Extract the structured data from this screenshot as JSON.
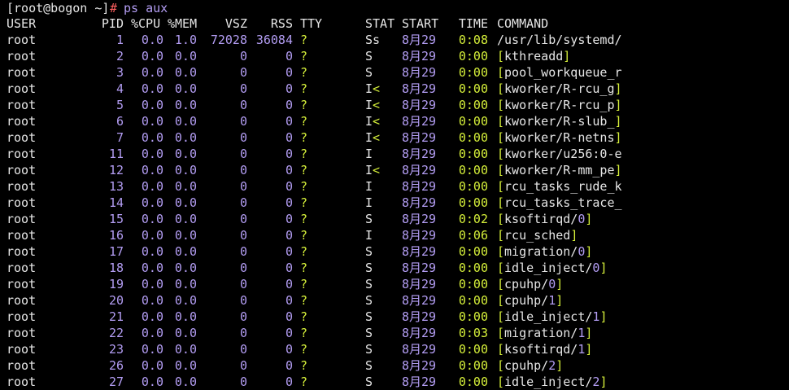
{
  "prompt": {
    "user_host": "[root@bogon ~]",
    "symbol": "#",
    "command": "ps aux"
  },
  "header": {
    "user": "USER",
    "pid": "PID",
    "cpu": "%CPU",
    "mem": "%MEM",
    "vsz": "VSZ",
    "rss": "RSS",
    "tty": "TTY",
    "stat": "STAT",
    "start": "START",
    "time": "TIME",
    "command": "COMMAND"
  },
  "colors": {
    "background": "#000000",
    "text": "#e6e6e6",
    "number": "#b39df3",
    "accent": "#d6f03a",
    "prompt_hash": "#ff5f5f"
  },
  "rows": [
    {
      "user": "root",
      "pid": "1",
      "cpu": "0.0",
      "mem": "1.0",
      "vsz": "72028",
      "rss": "36084",
      "tty": "?",
      "stat": "Ss",
      "start": "8月29",
      "time": "0:08",
      "command": "/usr/lib/systemd/",
      "bracket": false
    },
    {
      "user": "root",
      "pid": "2",
      "cpu": "0.0",
      "mem": "0.0",
      "vsz": "0",
      "rss": "0",
      "tty": "?",
      "stat": "S",
      "start": "8月29",
      "time": "0:00",
      "command": "kthreadd",
      "bracket": true,
      "close": "]"
    },
    {
      "user": "root",
      "pid": "3",
      "cpu": "0.0",
      "mem": "0.0",
      "vsz": "0",
      "rss": "0",
      "tty": "?",
      "stat": "S",
      "start": "8月29",
      "time": "0:00",
      "command": "pool_workqueue_r",
      "bracket": true,
      "close": ""
    },
    {
      "user": "root",
      "pid": "4",
      "cpu": "0.0",
      "mem": "0.0",
      "vsz": "0",
      "rss": "0",
      "tty": "?",
      "stat": "I<",
      "start": "8月29",
      "time": "0:00",
      "command": "kworker/R-rcu_g",
      "bracket": true,
      "close": "]"
    },
    {
      "user": "root",
      "pid": "5",
      "cpu": "0.0",
      "mem": "0.0",
      "vsz": "0",
      "rss": "0",
      "tty": "?",
      "stat": "I<",
      "start": "8月29",
      "time": "0:00",
      "command": "kworker/R-rcu_p",
      "bracket": true,
      "close": "]"
    },
    {
      "user": "root",
      "pid": "6",
      "cpu": "0.0",
      "mem": "0.0",
      "vsz": "0",
      "rss": "0",
      "tty": "?",
      "stat": "I<",
      "start": "8月29",
      "time": "0:00",
      "command": "kworker/R-slub_",
      "bracket": true,
      "close": "]"
    },
    {
      "user": "root",
      "pid": "7",
      "cpu": "0.0",
      "mem": "0.0",
      "vsz": "0",
      "rss": "0",
      "tty": "?",
      "stat": "I<",
      "start": "8月29",
      "time": "0:00",
      "command": "kworker/R-netns",
      "bracket": true,
      "close": "]"
    },
    {
      "user": "root",
      "pid": "11",
      "cpu": "0.0",
      "mem": "0.0",
      "vsz": "0",
      "rss": "0",
      "tty": "?",
      "stat": "I",
      "start": "8月29",
      "time": "0:00",
      "command": "kworker/u256:0-e",
      "bracket": true,
      "close": ""
    },
    {
      "user": "root",
      "pid": "12",
      "cpu": "0.0",
      "mem": "0.0",
      "vsz": "0",
      "rss": "0",
      "tty": "?",
      "stat": "I<",
      "start": "8月29",
      "time": "0:00",
      "command": "kworker/R-mm_pe",
      "bracket": true,
      "close": "]"
    },
    {
      "user": "root",
      "pid": "13",
      "cpu": "0.0",
      "mem": "0.0",
      "vsz": "0",
      "rss": "0",
      "tty": "?",
      "stat": "I",
      "start": "8月29",
      "time": "0:00",
      "command": "rcu_tasks_rude_k",
      "bracket": true,
      "close": ""
    },
    {
      "user": "root",
      "pid": "14",
      "cpu": "0.0",
      "mem": "0.0",
      "vsz": "0",
      "rss": "0",
      "tty": "?",
      "stat": "I",
      "start": "8月29",
      "time": "0:00",
      "command": "rcu_tasks_trace_",
      "bracket": true,
      "close": ""
    },
    {
      "user": "root",
      "pid": "15",
      "cpu": "0.0",
      "mem": "0.0",
      "vsz": "0",
      "rss": "0",
      "tty": "?",
      "stat": "S",
      "start": "8月29",
      "time": "0:02",
      "command": "ksoftirqd/0",
      "bracket": true,
      "close": "]"
    },
    {
      "user": "root",
      "pid": "16",
      "cpu": "0.0",
      "mem": "0.0",
      "vsz": "0",
      "rss": "0",
      "tty": "?",
      "stat": "I",
      "start": "8月29",
      "time": "0:06",
      "command": "rcu_sched",
      "bracket": true,
      "close": "]"
    },
    {
      "user": "root",
      "pid": "17",
      "cpu": "0.0",
      "mem": "0.0",
      "vsz": "0",
      "rss": "0",
      "tty": "?",
      "stat": "S",
      "start": "8月29",
      "time": "0:00",
      "command": "migration/0",
      "bracket": true,
      "close": "]"
    },
    {
      "user": "root",
      "pid": "18",
      "cpu": "0.0",
      "mem": "0.0",
      "vsz": "0",
      "rss": "0",
      "tty": "?",
      "stat": "S",
      "start": "8月29",
      "time": "0:00",
      "command": "idle_inject/0",
      "bracket": true,
      "close": "]"
    },
    {
      "user": "root",
      "pid": "19",
      "cpu": "0.0",
      "mem": "0.0",
      "vsz": "0",
      "rss": "0",
      "tty": "?",
      "stat": "S",
      "start": "8月29",
      "time": "0:00",
      "command": "cpuhp/0",
      "bracket": true,
      "close": "]"
    },
    {
      "user": "root",
      "pid": "20",
      "cpu": "0.0",
      "mem": "0.0",
      "vsz": "0",
      "rss": "0",
      "tty": "?",
      "stat": "S",
      "start": "8月29",
      "time": "0:00",
      "command": "cpuhp/1",
      "bracket": true,
      "close": "]"
    },
    {
      "user": "root",
      "pid": "21",
      "cpu": "0.0",
      "mem": "0.0",
      "vsz": "0",
      "rss": "0",
      "tty": "?",
      "stat": "S",
      "start": "8月29",
      "time": "0:00",
      "command": "idle_inject/1",
      "bracket": true,
      "close": "]"
    },
    {
      "user": "root",
      "pid": "22",
      "cpu": "0.0",
      "mem": "0.0",
      "vsz": "0",
      "rss": "0",
      "tty": "?",
      "stat": "S",
      "start": "8月29",
      "time": "0:03",
      "command": "migration/1",
      "bracket": true,
      "close": "]"
    },
    {
      "user": "root",
      "pid": "23",
      "cpu": "0.0",
      "mem": "0.0",
      "vsz": "0",
      "rss": "0",
      "tty": "?",
      "stat": "S",
      "start": "8月29",
      "time": "0:00",
      "command": "ksoftirqd/1",
      "bracket": true,
      "close": "]"
    },
    {
      "user": "root",
      "pid": "26",
      "cpu": "0.0",
      "mem": "0.0",
      "vsz": "0",
      "rss": "0",
      "tty": "?",
      "stat": "S",
      "start": "8月29",
      "time": "0:00",
      "command": "cpuhp/2",
      "bracket": true,
      "close": "]"
    },
    {
      "user": "root",
      "pid": "27",
      "cpu": "0.0",
      "mem": "0.0",
      "vsz": "0",
      "rss": "0",
      "tty": "?",
      "stat": "S",
      "start": "8月29",
      "time": "0:00",
      "command": "idle_inject/2",
      "bracket": true,
      "close": "]"
    }
  ]
}
